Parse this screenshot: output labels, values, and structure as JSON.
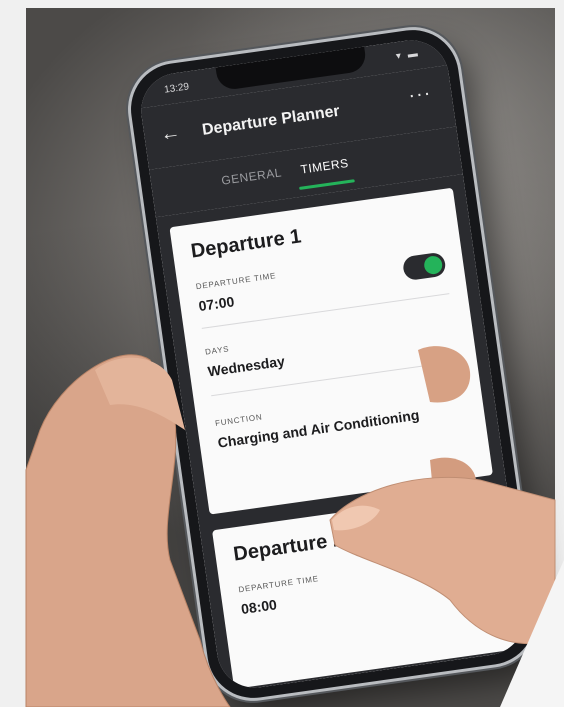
{
  "status": {
    "time": "13:29",
    "icons": "▾ ▬"
  },
  "appbar": {
    "title": "Departure Planner",
    "back_icon": "←",
    "more_icon": "···"
  },
  "tabs": [
    {
      "label": "GENERAL",
      "active": false
    },
    {
      "label": "TIMERS",
      "active": true
    }
  ],
  "colors": {
    "accent": "#24b35a",
    "dark": "#2a2b2f"
  },
  "departures": [
    {
      "title": "Departure 1",
      "time_label": "DEPARTURE TIME",
      "time": "07:00",
      "enabled": true,
      "days_label": "DAYS",
      "days": "Wednesday",
      "function_label": "FUNCTION",
      "function": "Charging and Air Conditioning"
    },
    {
      "title": "Departure 2",
      "time_label": "DEPARTURE TIME",
      "time": "08:00",
      "enabled": false
    }
  ]
}
